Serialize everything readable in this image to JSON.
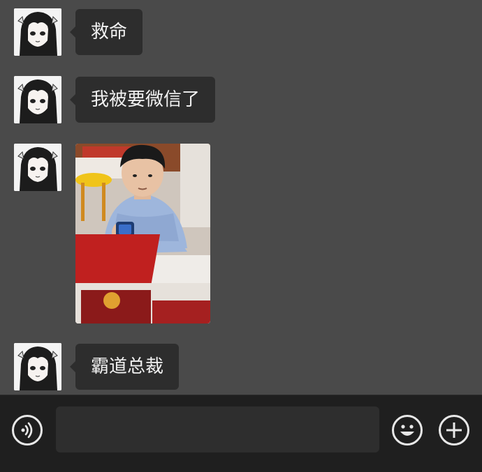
{
  "messages": [
    {
      "type": "text",
      "text": "救命"
    },
    {
      "type": "text",
      "text": "我被要微信了"
    },
    {
      "type": "image",
      "image_desc": "photo-boy-with-smartwatch"
    },
    {
      "type": "text",
      "text": "霸道总裁"
    }
  ],
  "input": {
    "value": "",
    "placeholder": ""
  },
  "icons": {
    "voice": "voice-icon",
    "emoji": "emoji-icon",
    "more": "plus-icon"
  },
  "colors": {
    "chat_background": "#4a4a4a",
    "bubble": "#2d2d2d",
    "bubble_text": "#f1f1f1",
    "input_bar": "#1f1f1f"
  }
}
